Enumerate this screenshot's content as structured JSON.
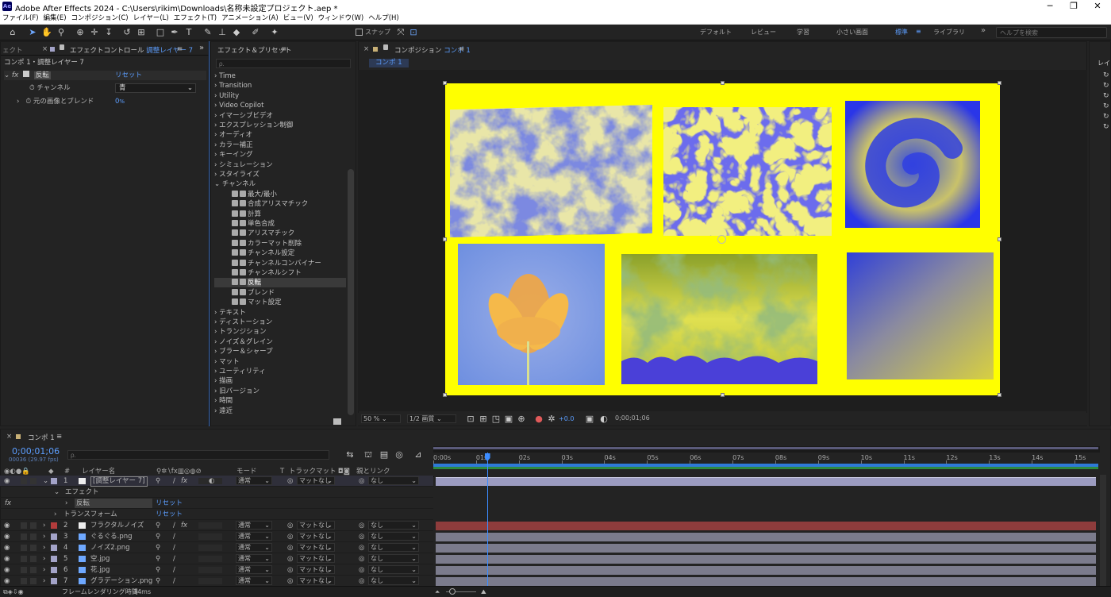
{
  "titlebar": {
    "title": "Adobe After Effects 2024 - C:\\Users\\rikim\\Downloads\\名称未設定プロジェクト.aep *",
    "logo": "Ae"
  },
  "menu": [
    "ファイル(F)",
    "編集(E)",
    "コンポジション(C)",
    "レイヤー(L)",
    "エフェクト(T)",
    "アニメーション(A)",
    "ビュー(V)",
    "ウィンドウ(W)",
    "ヘルプ(H)"
  ],
  "toolbar": {
    "snap_label": "スナップ",
    "workspaces": [
      "デフォルト",
      "レビュー",
      "学習",
      "小さい画面",
      "標準",
      "ライブラリ"
    ],
    "active_workspace": "標準",
    "help_placeholder": "ヘルプを検索"
  },
  "effect_controls": {
    "tab_prefix": "エフェクトコントロール",
    "tab_layer": "調整レイヤー 7",
    "left_cut": "ェクト",
    "header": "コンポ 1・調整レイヤー 7",
    "effect_name": "反転",
    "reset": "リセット",
    "channel_label": "チャンネル",
    "channel_value": "青",
    "blend_label": "元の画像とブレンド",
    "blend_value": "0",
    "blend_unit": "%"
  },
  "effects_presets": {
    "tab": "エフェクト＆プリセット",
    "search_placeholder": "ρ.",
    "categories": [
      "Time",
      "Transition",
      "Utility",
      "Video Copilot",
      "イマーシブビデオ",
      "エクスプレッション制御",
      "オーディオ",
      "カラー補正",
      "キーイング",
      "シミュレーション",
      "スタイライズ",
      "チャンネル"
    ],
    "channel_items": [
      "最大/最小",
      "合成アリスマチック",
      "計算",
      "単色合成",
      "アリスマチック",
      "カラーマット削除",
      "チャンネル設定",
      "チャンネルコンバイナー",
      "チャンネルシフト",
      "反転",
      "ブレンド",
      "マット設定"
    ],
    "selected_item": "反転",
    "categories_after": [
      "テキスト",
      "ディストーション",
      "トランジション",
      "ノイズ＆グレイン",
      "ブラー＆シャープ",
      "マット",
      "ユーティリティ",
      "描画",
      "旧バージョン",
      "時間",
      "遠近"
    ]
  },
  "composition": {
    "tab_prefix": "コンポジション",
    "tab_name": "コンポ 1",
    "breadcrumb": "コンポ 1",
    "zoom": "50 %",
    "resolution": "1/2 画質",
    "exposure": "+0.0",
    "timecode": "0;00;01;06",
    "background": "#ffff00"
  },
  "right_strip_label": "レイ",
  "timeline": {
    "tab": "コンポ 1",
    "timecode": "0;00;01;06",
    "frame_info": "00036 (29.97 fps)",
    "search_placeholder": "ρ.",
    "col_layer_name": "レイヤー名",
    "col_mode": "モード",
    "col_t": "T",
    "col_trackmatte": "トラックマット",
    "col_parent": "親とリンク",
    "col_hash": "#",
    "ticks": [
      "0:00s",
      "01s",
      "02s",
      "03s",
      "04s",
      "05s",
      "06s",
      "07s",
      "08s",
      "09s",
      "10s",
      "11s",
      "12s",
      "13s",
      "14s",
      "15s"
    ],
    "playhead_fraction": 0.08,
    "layers": [
      {
        "num": "1",
        "name": "[調整レイヤー 7]",
        "color": "#a3a3c8",
        "mode": "通常",
        "matte": "マットなし",
        "parent": "なし",
        "bar": "adjust"
      },
      {
        "num": "2",
        "name": "フラクタルノイズ",
        "color": "#b33c3c",
        "mode": "通常",
        "matte": "マットなし",
        "parent": "なし",
        "bar": "red"
      },
      {
        "num": "3",
        "name": "ぐるぐる.png",
        "color": "#a3a3c8",
        "mode": "通常",
        "matte": "マットなし",
        "parent": "なし",
        "bar": "gray"
      },
      {
        "num": "4",
        "name": "ノイズ2.png",
        "color": "#a3a3c8",
        "mode": "通常",
        "matte": "マットなし",
        "parent": "なし",
        "bar": "gray"
      },
      {
        "num": "5",
        "name": "空.jpg",
        "color": "#a3a3c8",
        "mode": "通常",
        "matte": "マットなし",
        "parent": "なし",
        "bar": "gray"
      },
      {
        "num": "6",
        "name": "花.jpg",
        "color": "#a3a3c8",
        "mode": "通常",
        "matte": "マットなし",
        "parent": "なし",
        "bar": "gray"
      },
      {
        "num": "7",
        "name": "グラデーション.png",
        "color": "#a3a3c8",
        "mode": "通常",
        "matte": "マットなし",
        "parent": "なし",
        "bar": "gray"
      }
    ],
    "effect_group": "エフェクト",
    "effect_name": "反転",
    "transform_group": "トランスフォーム",
    "reset": "リセット",
    "render_time_label": "フレームレンダリング時間",
    "render_time": "34ms",
    "fx_label": "fx"
  }
}
